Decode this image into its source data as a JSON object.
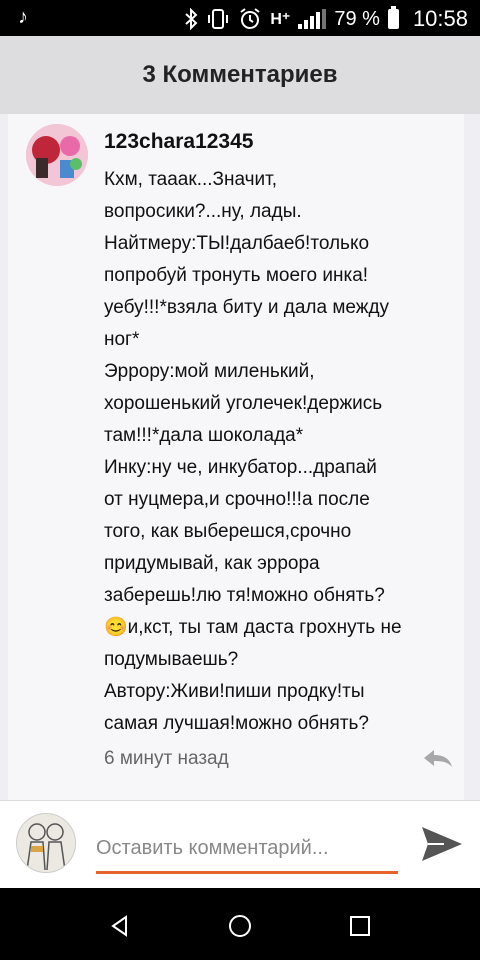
{
  "status_bar": {
    "app_icon": "music-note-icon",
    "icons": [
      "bluetooth-icon",
      "vibrate-icon",
      "alarm-icon"
    ],
    "network": "H⁺",
    "battery": "79 %",
    "time": "10:58"
  },
  "header": {
    "title": "3 Комментариев"
  },
  "comment": {
    "author": "123chara12345",
    "text": "Кхм, тааак...Значит,\nвопросики?...ну, лады.\nНайтмеру:ТЫ!далбаеб!только\nпопробуй тронуть моего инка!\nуебу!!!*взяла биту и дала между\nног*\nЭррору:мой миленький,\nхорошенький уголечек!держись\nтам!!!*дала шоколада*\nИнку:ну че, инкубатор...драпай\nот нуцмера,и срочно!!!а после\nтого, как выберешся,срочно\nпридумывай, как эррора\nзаберешь!лю тя!можно обнять?\n😊и,кст, ты там даста грохнуть не\nподумываешь?\nАвтору:Живи!пиши продку!ты\nсамая лучшая!можно обнять?",
    "time_ago": "6 минут назад",
    "reply_icon": "reply-icon"
  },
  "composer": {
    "placeholder": "Оставить комментарий...",
    "accent_color": "#e8622c",
    "send_icon": "send-icon"
  },
  "nav_bar": {
    "back": "back-icon",
    "home": "home-icon",
    "recents": "recents-icon"
  }
}
